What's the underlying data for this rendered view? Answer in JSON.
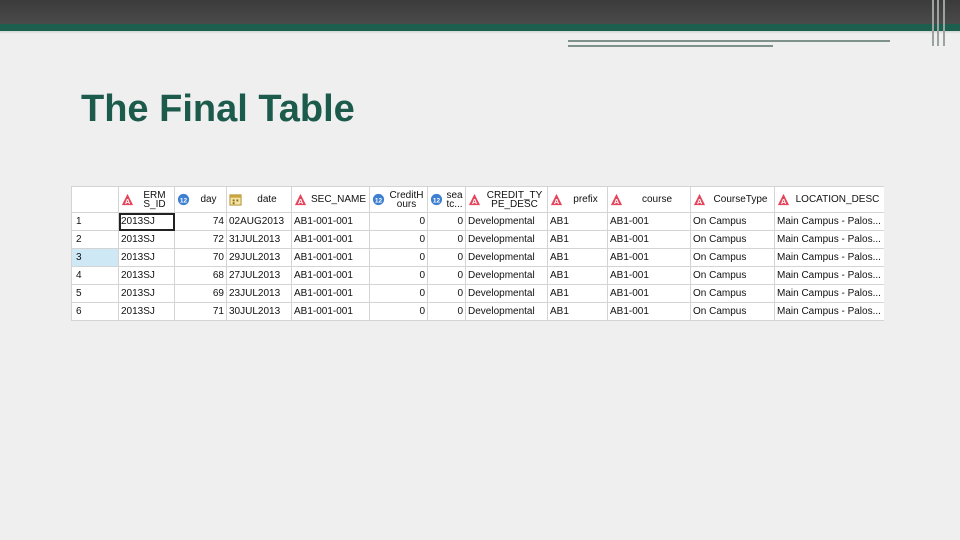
{
  "slide": {
    "title": "The Final Table"
  },
  "colors": {
    "title": "#1c5a4c",
    "banner_dark": "#3b3b3b",
    "banner_green": "#1c5f4f",
    "selected_row": "#cfe8f6"
  },
  "table": {
    "columns": [
      {
        "label_line1": "ERM",
        "label_line2": "S_ID",
        "icon": "char-type-icon"
      },
      {
        "label_line1": "day",
        "label_line2": "",
        "icon": "numeric-type-icon"
      },
      {
        "label_line1": "date",
        "label_line2": "",
        "icon": "date-type-icon"
      },
      {
        "label_line1": "SEC_NAME",
        "label_line2": "",
        "icon": "char-type-icon"
      },
      {
        "label_line1": "CreditH",
        "label_line2": "ours",
        "icon": "numeric-type-icon"
      },
      {
        "label_line1": "sea",
        "label_line2": "tc...",
        "icon": "numeric-type-icon"
      },
      {
        "label_line1": "CREDIT_TY",
        "label_line2": "PE_DESC",
        "icon": "char-type-icon"
      },
      {
        "label_line1": "prefix",
        "label_line2": "",
        "icon": "char-type-icon"
      },
      {
        "label_line1": "course",
        "label_line2": "",
        "icon": "char-type-icon"
      },
      {
        "label_line1": "CourseType",
        "label_line2": "",
        "icon": "char-type-icon"
      },
      {
        "label_line1": "LOCATION_DESC",
        "label_line2": "",
        "icon": "char-type-icon"
      }
    ],
    "rows": [
      {
        "n": "1",
        "c": [
          "2013SJ",
          "74",
          "02AUG2013",
          "AB1-001-001",
          "0",
          "0",
          "Developmental",
          "AB1",
          "AB1-001",
          "On Campus",
          "Main Campus - Palos..."
        ]
      },
      {
        "n": "2",
        "c": [
          "2013SJ",
          "72",
          "31JUL2013",
          "AB1-001-001",
          "0",
          "0",
          "Developmental",
          "AB1",
          "AB1-001",
          "On Campus",
          "Main Campus - Palos..."
        ]
      },
      {
        "n": "3",
        "c": [
          "2013SJ",
          "70",
          "29JUL2013",
          "AB1-001-001",
          "0",
          "0",
          "Developmental",
          "AB1",
          "AB1-001",
          "On Campus",
          "Main Campus - Palos..."
        ]
      },
      {
        "n": "4",
        "c": [
          "2013SJ",
          "68",
          "27JUL2013",
          "AB1-001-001",
          "0",
          "0",
          "Developmental",
          "AB1",
          "AB1-001",
          "On Campus",
          "Main Campus - Palos..."
        ]
      },
      {
        "n": "5",
        "c": [
          "2013SJ",
          "69",
          "23JUL2013",
          "AB1-001-001",
          "0",
          "0",
          "Developmental",
          "AB1",
          "AB1-001",
          "On Campus",
          "Main Campus - Palos..."
        ]
      },
      {
        "n": "6",
        "c": [
          "2013SJ",
          "71",
          "30JUL2013",
          "AB1-001-001",
          "0",
          "0",
          "Developmental",
          "AB1",
          "AB1-001",
          "On Campus",
          "Main Campus - Palos..."
        ]
      }
    ]
  }
}
